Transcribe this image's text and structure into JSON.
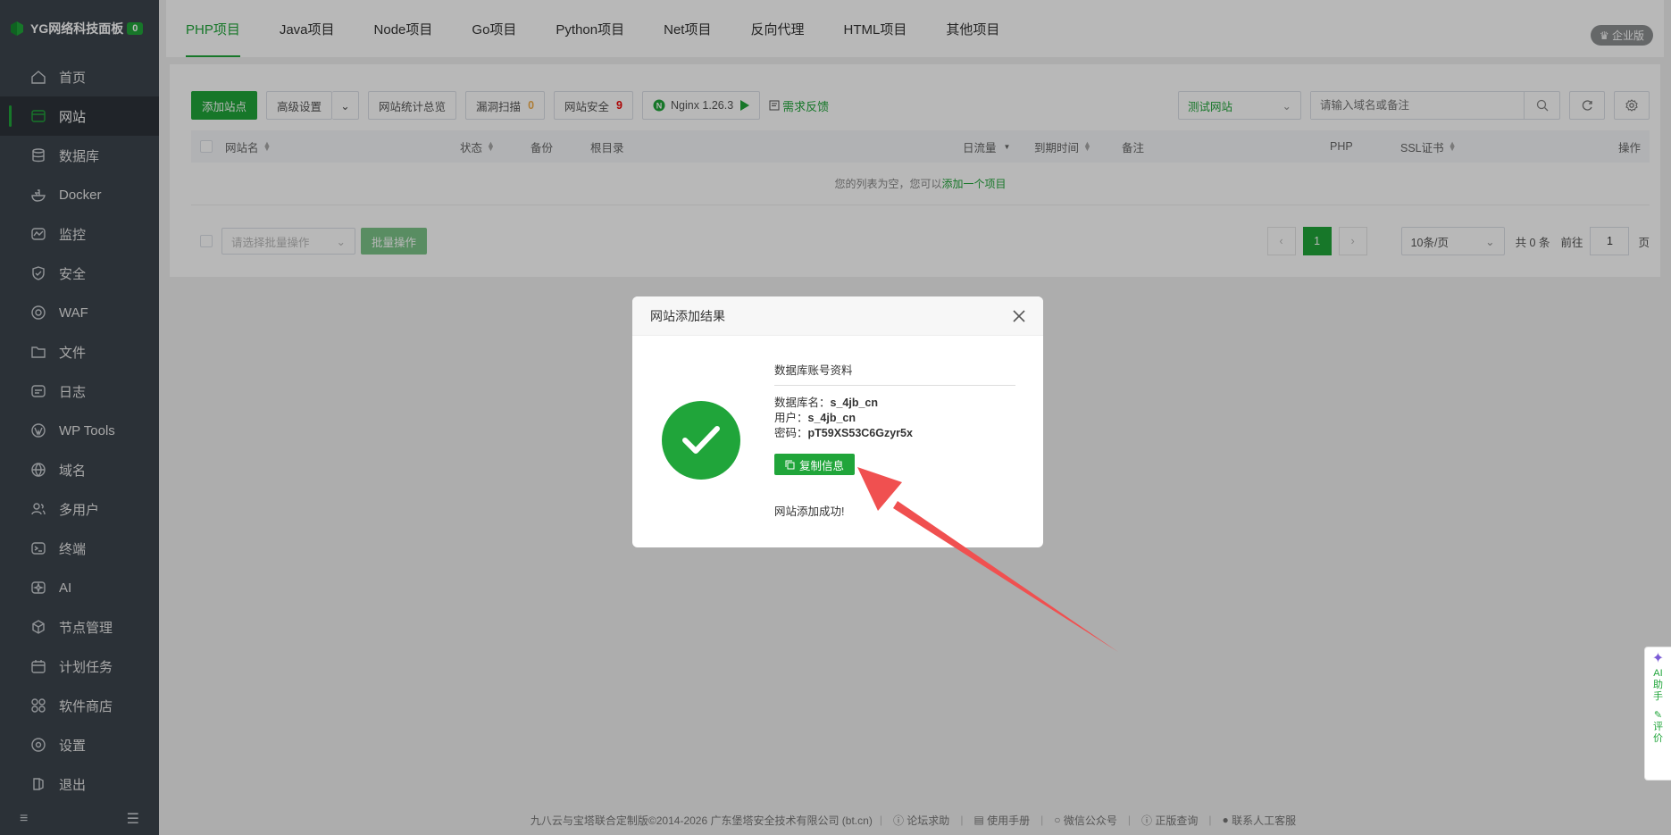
{
  "brand": {
    "name": "YG网络科技面板",
    "badge": "0"
  },
  "sidebar": {
    "items": [
      {
        "label": "首页",
        "icon": "home-icon"
      },
      {
        "label": "网站",
        "icon": "globe-icon"
      },
      {
        "label": "数据库",
        "icon": "database-icon"
      },
      {
        "label": "Docker",
        "icon": "docker-icon"
      },
      {
        "label": "监控",
        "icon": "monitor-icon"
      },
      {
        "label": "安全",
        "icon": "shield-icon"
      },
      {
        "label": "WAF",
        "icon": "waf-icon"
      },
      {
        "label": "文件",
        "icon": "folder-icon"
      },
      {
        "label": "日志",
        "icon": "log-icon"
      },
      {
        "label": "WP Tools",
        "icon": "wordpress-icon"
      },
      {
        "label": "域名",
        "icon": "domain-icon"
      },
      {
        "label": "多用户",
        "icon": "users-icon"
      },
      {
        "label": "终端",
        "icon": "terminal-icon"
      },
      {
        "label": "AI",
        "icon": "ai-icon"
      },
      {
        "label": "节点管理",
        "icon": "node-icon"
      },
      {
        "label": "计划任务",
        "icon": "calendar-icon"
      },
      {
        "label": "软件商店",
        "icon": "apps-icon"
      },
      {
        "label": "设置",
        "icon": "settings-icon"
      },
      {
        "label": "退出",
        "icon": "logout-icon"
      }
    ],
    "active_index": 1
  },
  "tabs": [
    "PHP项目",
    "Java项目",
    "Node项目",
    "Go项目",
    "Python项目",
    "Net项目",
    "反向代理",
    "HTML项目",
    "其他项目"
  ],
  "edition": "企业版",
  "toolbar": {
    "add_site": "添加站点",
    "advanced": "高级设置",
    "stats": "网站统计总览",
    "vuln_scan": "漏洞扫描",
    "vuln_count": "0",
    "site_security": "网站安全",
    "security_count": "9",
    "nginx": "Nginx 1.26.3",
    "feedback": "需求反馈",
    "category": "测试网站",
    "search_placeholder": "请输入域名或备注"
  },
  "table": {
    "columns": {
      "name": "网站名",
      "status": "状态",
      "backup": "备份",
      "root": "根目录",
      "traffic": "日流量",
      "expire": "到期时间",
      "remark": "备注",
      "php": "PHP",
      "ssl": "SSL证书",
      "ops": "操作"
    },
    "empty_text": "您的列表为空，您可以",
    "empty_link": "添加一个项目"
  },
  "batch": {
    "placeholder": "请选择批量操作",
    "button": "批量操作"
  },
  "pagination": {
    "current": "1",
    "per_page": "10条/页",
    "total": "共 0 条",
    "goto": "前往",
    "goto_value": "1",
    "page_unit": "页"
  },
  "modal": {
    "title": "网站添加结果",
    "section": "数据库账号资料",
    "db_name_label": "数据库名：",
    "db_name": "s_4jb_cn",
    "user_label": "用户：",
    "user": "s_4jb_cn",
    "password_label": "密码：",
    "password": "pT59XS53C6Gzyr5x",
    "copy_button": "复制信息",
    "success_text": "网站添加成功!"
  },
  "side_float": {
    "ai": "AI助手",
    "rate": "评价"
  },
  "footer": {
    "copyright": "九八云与宝塔联合定制版©2014-2026 广东堡塔安全技术有限公司 (bt.cn)",
    "links": [
      "论坛求助",
      "使用手册",
      "微信公众号",
      "正版查询",
      "联系人工客服"
    ]
  },
  "colors": {
    "brand_green": "#20a53a",
    "sidebar_bg": "#3c444d",
    "arrow_red": "#f05050"
  }
}
